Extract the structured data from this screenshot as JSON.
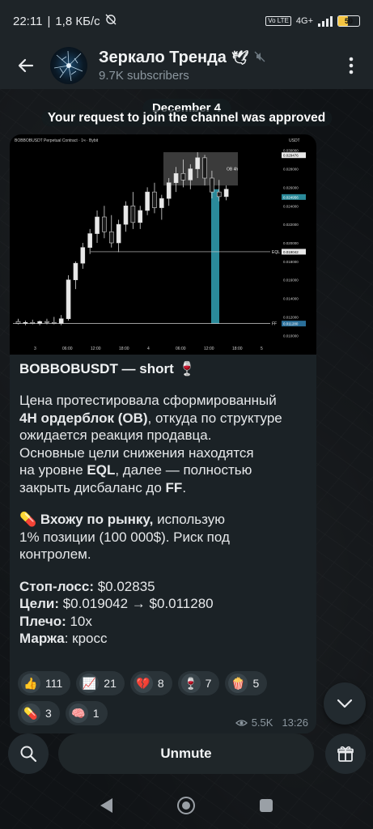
{
  "status_bar": {
    "time": "22:11",
    "speed": "1,8 КБ/с",
    "network_label": "4G+",
    "lte_label": "Vo LTE",
    "battery": "50"
  },
  "header": {
    "back_icon": "arrow-left-icon",
    "channel_title": "Зеркало Тренда",
    "channel_subtitle": "9.7K subscribers",
    "menu_icon": "more-vert-icon"
  },
  "service": {
    "date": "December 4",
    "message": "Your request to join the channel was approved"
  },
  "chart": {
    "title": "BOBBOBUSDT Perpetual Contract · 1ч · Bybit",
    "currency_label": "USDT",
    "price_ticks": [
      "0.030000",
      "0.029476",
      "0.028000",
      "0.026000",
      "0.024956",
      "0.024000",
      "0.022000",
      "0.020000",
      "0.019042",
      "0.018000",
      "0.016000",
      "0.014000",
      "0.012000",
      "0.011280",
      "0.010000"
    ],
    "time_ticks": [
      "3",
      "06:00",
      "12:00",
      "18:00",
      "4",
      "06:00",
      "12:00",
      "18:00",
      "5"
    ],
    "ob_label": "OB 4h",
    "eql_label": "EQL",
    "ff_label": "FF"
  },
  "chart_data": {
    "type": "candlestick",
    "title": "BOBBOBUSDT Perpetual Contract · 1ч · Bybit",
    "ylabel": "USDT",
    "ylim": [
      0.0095,
      0.0305
    ],
    "levels": [
      {
        "name": "EQL",
        "value": 0.019042
      },
      {
        "name": "FF",
        "value": 0.01128
      }
    ],
    "zone": {
      "name": "OB 4h",
      "low": 0.0262,
      "high": 0.0298
    },
    "candles": [
      {
        "o": 0.0115,
        "h": 0.0118,
        "l": 0.0112,
        "c": 0.0113
      },
      {
        "o": 0.0113,
        "h": 0.0116,
        "l": 0.0111,
        "c": 0.0114
      },
      {
        "o": 0.0114,
        "h": 0.0117,
        "l": 0.0112,
        "c": 0.0113
      },
      {
        "o": 0.0113,
        "h": 0.0116,
        "l": 0.0111,
        "c": 0.0115
      },
      {
        "o": 0.0115,
        "h": 0.0118,
        "l": 0.0112,
        "c": 0.0114
      },
      {
        "o": 0.0114,
        "h": 0.012,
        "l": 0.0112,
        "c": 0.0113
      },
      {
        "o": 0.0113,
        "h": 0.0122,
        "l": 0.0111,
        "c": 0.0118
      },
      {
        "o": 0.0118,
        "h": 0.0165,
        "l": 0.0116,
        "c": 0.016
      },
      {
        "o": 0.016,
        "h": 0.018,
        "l": 0.015,
        "c": 0.0178
      },
      {
        "o": 0.0178,
        "h": 0.02,
        "l": 0.0172,
        "c": 0.0195
      },
      {
        "o": 0.0195,
        "h": 0.0215,
        "l": 0.0188,
        "c": 0.021
      },
      {
        "o": 0.021,
        "h": 0.0235,
        "l": 0.02,
        "c": 0.0228
      },
      {
        "o": 0.0228,
        "h": 0.024,
        "l": 0.0205,
        "c": 0.0212
      },
      {
        "o": 0.0212,
        "h": 0.023,
        "l": 0.0195,
        "c": 0.02
      },
      {
        "o": 0.02,
        "h": 0.0225,
        "l": 0.019,
        "c": 0.022
      },
      {
        "o": 0.022,
        "h": 0.0245,
        "l": 0.0212,
        "c": 0.024
      },
      {
        "o": 0.024,
        "h": 0.0255,
        "l": 0.0215,
        "c": 0.0222
      },
      {
        "o": 0.0222,
        "h": 0.024,
        "l": 0.0215,
        "c": 0.0235
      },
      {
        "o": 0.0235,
        "h": 0.026,
        "l": 0.023,
        "c": 0.0255
      },
      {
        "o": 0.0255,
        "h": 0.0265,
        "l": 0.0232,
        "c": 0.0238
      },
      {
        "o": 0.0238,
        "h": 0.0252,
        "l": 0.0225,
        "c": 0.0248
      },
      {
        "o": 0.0248,
        "h": 0.027,
        "l": 0.024,
        "c": 0.0265
      },
      {
        "o": 0.0265,
        "h": 0.0282,
        "l": 0.0255,
        "c": 0.0275
      },
      {
        "o": 0.0275,
        "h": 0.029,
        "l": 0.026,
        "c": 0.0268
      },
      {
        "o": 0.0268,
        "h": 0.0285,
        "l": 0.0258,
        "c": 0.028
      },
      {
        "o": 0.028,
        "h": 0.0298,
        "l": 0.027,
        "c": 0.0292
      },
      {
        "o": 0.0292,
        "h": 0.0295,
        "l": 0.0262,
        "c": 0.027
      },
      {
        "o": 0.027,
        "h": 0.0278,
        "l": 0.0248,
        "c": 0.0255
      },
      {
        "o": 0.0255,
        "h": 0.0268,
        "l": 0.0245,
        "c": 0.025
      },
      {
        "o": 0.025,
        "h": 0.0262,
        "l": 0.0246,
        "c": 0.0258
      }
    ]
  },
  "message": {
    "title": "BOBBOBUSDT — short",
    "title_emoji": "🍷",
    "p1_a": "Цена протестировала сформированный",
    "p1_b_bold": "4H ордерблок (OB)",
    "p1_b_rest": ", откуда по структуре",
    "p1_c": "ожидается реакция продавца.",
    "p1_d": "Основные цели снижения находятся",
    "p1_e_a": "на уровне ",
    "p1_e_bold": "EQL",
    "p1_e_b": ", далее — полностью",
    "p1_f_a": "закрыть дисбаланс до ",
    "p1_f_bold": "FF",
    "p1_f_b": ".",
    "p2_emoji": "💊",
    "p2_bold": "Вхожу по рынку,",
    "p2_rest": " использую",
    "p2_b": "1% позиции (100 000$). Риск под",
    "p2_c": "контролем.",
    "sl_label": "Стоп-лосс:",
    "sl_value": " $0.02835",
    "tp_label": "Цели:",
    "tp_value": " $0.019042 → $0.011280",
    "lev_label": "Плечо:",
    "lev_value": " 10x",
    "margin_label": "Маржа",
    "margin_value": ": кросс",
    "views": "5.5K",
    "time": "13:26"
  },
  "reactions": [
    {
      "icon": "👍",
      "count": "111"
    },
    {
      "icon": "📈",
      "count": "21"
    },
    {
      "icon": "💔",
      "count": "8"
    },
    {
      "icon": "🍷",
      "count": "7"
    },
    {
      "icon": "🍿",
      "count": "5"
    },
    {
      "icon": "💊",
      "count": "3"
    },
    {
      "icon": "🧠",
      "count": "1"
    }
  ],
  "bottom": {
    "unmute_label": "Unmute"
  },
  "colors": {
    "up": "#e8e8e8",
    "down": "#1a1a1a",
    "accent_teal": "#2a8a9a",
    "bubble": "#1b2226"
  }
}
